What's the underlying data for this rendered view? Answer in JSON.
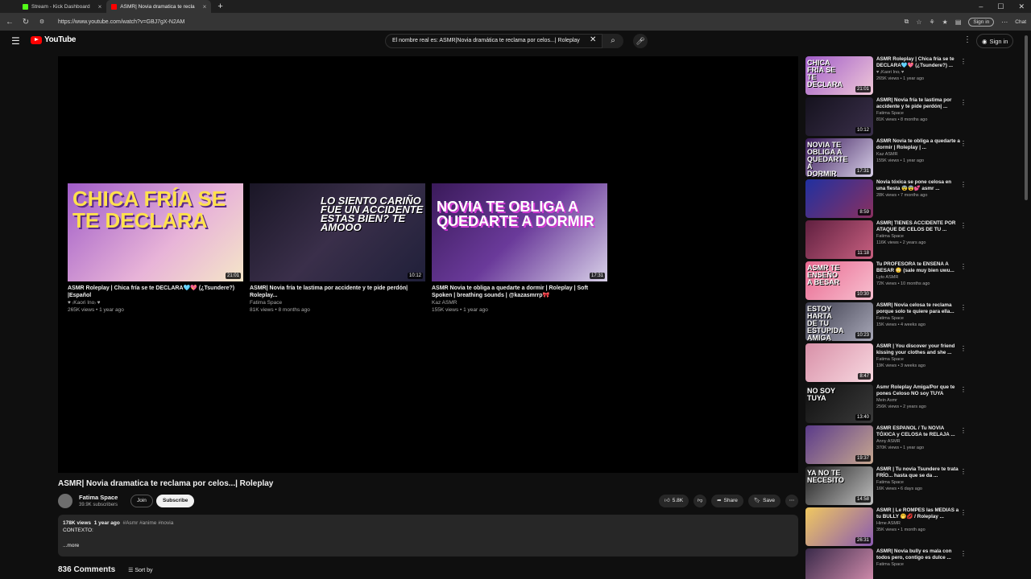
{
  "browser": {
    "tabs": [
      {
        "label": "Stream - Kick Dashboard",
        "color": "#53fc18"
      },
      {
        "label": "ASMR| Novia dramatica te recla",
        "color": "#ff0000"
      }
    ],
    "url": "https://www.youtube.com/watch?v=GBJ7gX-N2AM",
    "signin": "Sign in",
    "chat": "Chat"
  },
  "header": {
    "logo": "YouTube",
    "search_value": "El nombre real es: ASMR|Novia dramática te reclama por celos...| Roleplay",
    "signin": "Sign in"
  },
  "endcards": [
    {
      "thumb_text": "CHICA FRÍA SE TE DECLARA",
      "duration": "21:01",
      "title": "ASMR Roleplay | Chica fría se te DECLARA🩵💖 (¿Tsundere?) |Español",
      "channel": "♥ ₍Kaori Ino₎ ♥",
      "meta": "265K views • 1 year ago",
      "bg": "linear-gradient(135deg,#a05cc8,#e8b4d8 60%,#f5e6c8)"
    },
    {
      "thumb_text": "LO SIENTO CARIÑO FUE UN ACCIDENTE ESTAS BIEN? TE AMOOO",
      "duration": "10:12",
      "title": "ASMR| Novia fría te lastima por accidente y te pide perdón| Roleplay...",
      "channel": "Fatima Space",
      "meta": "81K views • 8 months ago",
      "bg": "linear-gradient(135deg,#1a1626,#3a2f4a 50%,#20203a)"
    },
    {
      "thumb_text": "NOVIA TE OBLIGA A QUEDARTE A DORMIR",
      "duration": "17:31",
      "title": "ASMR Novia te obliga a quedarte a dormir | Roleplay | Soft Spoken | breathing sounds | @kazasmrrp🎀",
      "channel": "Kaz ASMR",
      "meta": "155K views • 1 year ago",
      "bg": "linear-gradient(135deg,#3a1a5a,#6a3a9a 50%,#d8d0e8)"
    }
  ],
  "video": {
    "title": "ASMR| Novia dramatica te reclama por celos...| Roleplay",
    "channel": "Fatima Space",
    "subscribers": "39.9K subscribers",
    "join": "Join",
    "subscribe": "Subscribe",
    "likes": "5.8K",
    "share": "Share",
    "save": "Save",
    "views": "178K views",
    "age": "1 year ago",
    "tags": "#Asmr #anime #novia",
    "description": "CONTEXTO:",
    "more": "...more",
    "comments_count": "836 Comments",
    "sort_by": "Sort by"
  },
  "sidebar": [
    {
      "thumb_text": "CHICA FRÍA SE TE DECLARA",
      "duration": "21:01",
      "title": "ASMR Roleplay | Chica fría se te DECLARA🩵💖 (¿Tsundere?) ...",
      "channel": "♥ ₍Kaori Ino₎ ♥",
      "meta": "265K views • 1 year ago",
      "bg": "linear-gradient(135deg,#a05cc8,#f0c8d8)"
    },
    {
      "thumb_text": "",
      "duration": "10:12",
      "title": "ASMR| Novia fría te lastima por accidente y te pide perdón| ...",
      "channel": "Fatima Space",
      "meta": "81K views • 8 months ago",
      "bg": "linear-gradient(135deg,#15121e,#3a2f4a)"
    },
    {
      "thumb_text": "NOVIA TE OBLIGA A QUEDARTE A DORMIR",
      "duration": "17:31",
      "title": "ASMR Novia te obliga a quedarte a dormir | Roleplay | ...",
      "channel": "Kaz ASMR",
      "meta": "155K views • 1 year ago",
      "bg": "linear-gradient(135deg,#3a1a5a,#d8d0e8)"
    },
    {
      "thumb_text": "",
      "duration": "8:59",
      "title": "Novia tóxica se pone celosa en una fiesta 😨😨💕 asmr ...",
      "channel": "",
      "meta": "28K views • 7 months ago",
      "bg": "linear-gradient(135deg,#2030a0,#8a3060)"
    },
    {
      "thumb_text": "",
      "duration": "11:18",
      "title": "ASMR| TIENES ACCIDENTE POR ATAQUE DE CELOS DE TU ...",
      "channel": "Fatima Space",
      "meta": "116K views • 2 years ago",
      "bg": "linear-gradient(135deg,#602040,#c86080)"
    },
    {
      "thumb_text": "ASMR TE ENSEÑO A BESAR",
      "duration": "10:30",
      "title": "Tu PROFESORA te ENSEÑA A BESAR 😳 (sale muy bien uwu...",
      "channel": "Lyto ASMR",
      "meta": "72K views • 10 months ago",
      "bg": "linear-gradient(135deg,#e86890,#f8c0d0)"
    },
    {
      "thumb_text": "ESTOY HARTA DE TU ESTUPIDA AMIGA",
      "duration": "10:23",
      "title": "ASMR| Novia celosa te reclama porque solo te quiere para ella...",
      "channel": "Fatima Space",
      "meta": "15K views • 4 weeks ago",
      "bg": "linear-gradient(135deg,#3a3a4a,#a8a8b8)"
    },
    {
      "thumb_text": "",
      "duration": "8:47",
      "title": "ASMR | You discover your friend kissing your clothes and she ...",
      "channel": "Fatima Space",
      "meta": "19K views • 3 weeks ago",
      "bg": "linear-gradient(135deg,#d890a8,#f8d8e0)"
    },
    {
      "thumb_text": "NO SOY TUYA",
      "duration": "13:40",
      "title": "Asmr Roleplay Amiga/Por que te pones Celoso NO soy TUYA",
      "channel": "Mein Asmr",
      "meta": "256K views • 2 years ago",
      "bg": "linear-gradient(135deg,#101010,#3a3a3a)"
    },
    {
      "thumb_text": "",
      "duration": "19:37",
      "title": "ASMR ESPAÑOL / Tu NOVIA TÓXICA y CELOSA  te RELAJA ...",
      "channel": "Anny ASMR",
      "meta": "370K views • 1 year ago",
      "bg": "linear-gradient(135deg,#5a3a8a,#c8a890)"
    },
    {
      "thumb_text": "YA NO TE NECESITO",
      "duration": "14:58",
      "title": "ASMR | Tu novia Tsundere te trata FRÍO... hasta que se da ...",
      "channel": "Fatima Space",
      "meta": "16K views • 6 days ago",
      "bg": "linear-gradient(135deg,#202020,#c0c0c0)"
    },
    {
      "thumb_text": "",
      "duration": "26:31",
      "title": "ASMR | Le ROMPES las MEDIAS a tu BULLY 🤭💋 / Roleplay ...",
      "channel": "Hime ASMR",
      "meta": "35K views • 1 month ago",
      "bg": "linear-gradient(135deg,#f0c860,#8a5ab0)"
    },
    {
      "thumb_text": "",
      "duration": "",
      "title": "ASMR| Novia bully es mala con todos pero, contigo es dulce ...",
      "channel": "Fatima Space",
      "meta": "",
      "bg": "linear-gradient(135deg,#3a2a4a,#d890b0)"
    }
  ]
}
